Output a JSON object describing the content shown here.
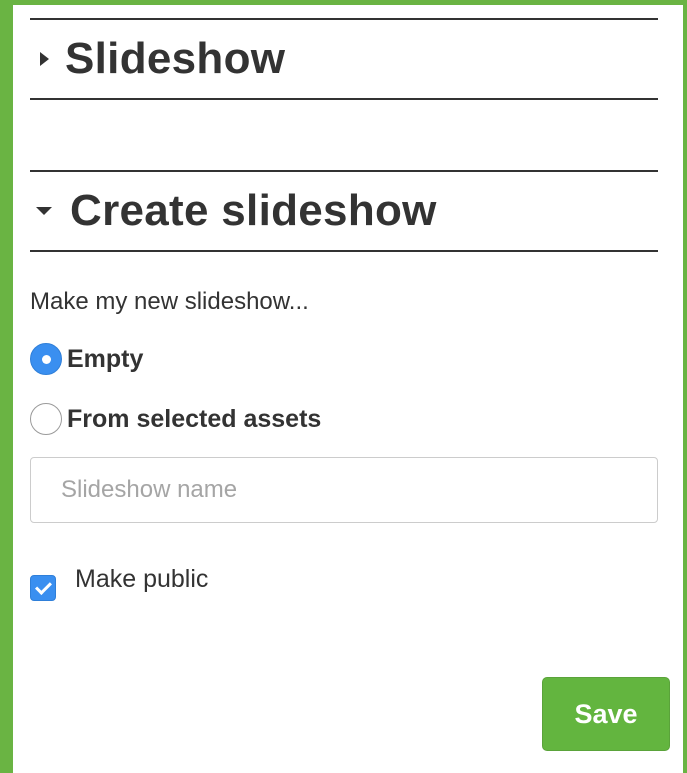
{
  "slideshow_section": {
    "title": "Slideshow",
    "caret": "caret-right-icon"
  },
  "create_section": {
    "title": "Create slideshow",
    "caret": "caret-down-icon",
    "intro": "Make my new slideshow...",
    "options": [
      {
        "label": "Empty",
        "selected": true
      },
      {
        "label": "From selected assets",
        "selected": false
      }
    ],
    "name_input": {
      "value": "",
      "placeholder": "Slideshow name"
    },
    "make_public": {
      "label": "Make public",
      "checked": true
    },
    "save_label": "Save"
  },
  "colors": {
    "frame_border": "#6ab443",
    "accent_blue": "#3a8ff0",
    "save_green": "#63b53f",
    "text": "#333333"
  }
}
